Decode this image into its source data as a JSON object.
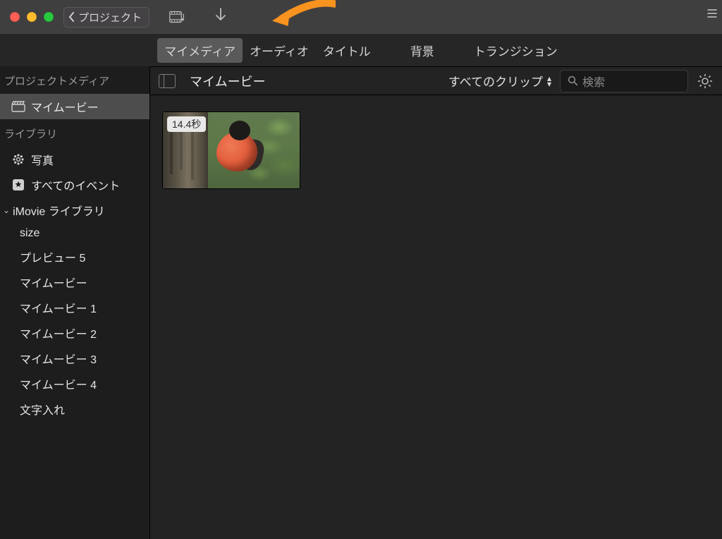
{
  "titlebar": {
    "back_label": "プロジェクト"
  },
  "tabs": {
    "my_media": "マイメディア",
    "audio": "オーディオ",
    "titles": "タイトル",
    "background": "背景",
    "transition": "トランジション"
  },
  "sidebar": {
    "section_project_media": "プロジェクトメディア",
    "my_movie_item": "マイムービー",
    "section_library": "ライブラリ",
    "photos": "写真",
    "all_events": "すべてのイベント",
    "imovie_library": "iMovie ライブラリ",
    "children": {
      "c0": "size",
      "c1": "プレビュー 5",
      "c2": "マイムービー",
      "c3": "マイムービー 1",
      "c4": "マイムービー 2",
      "c5": "マイムービー 3",
      "c6": "マイムービー 4",
      "c7": "文字入れ"
    }
  },
  "content": {
    "title": "マイムービー",
    "filter_label": "すべてのクリップ",
    "search_placeholder": "検索",
    "clip_duration": "14.4秒"
  },
  "colors": {
    "accent_arrow": "#f7931e"
  }
}
